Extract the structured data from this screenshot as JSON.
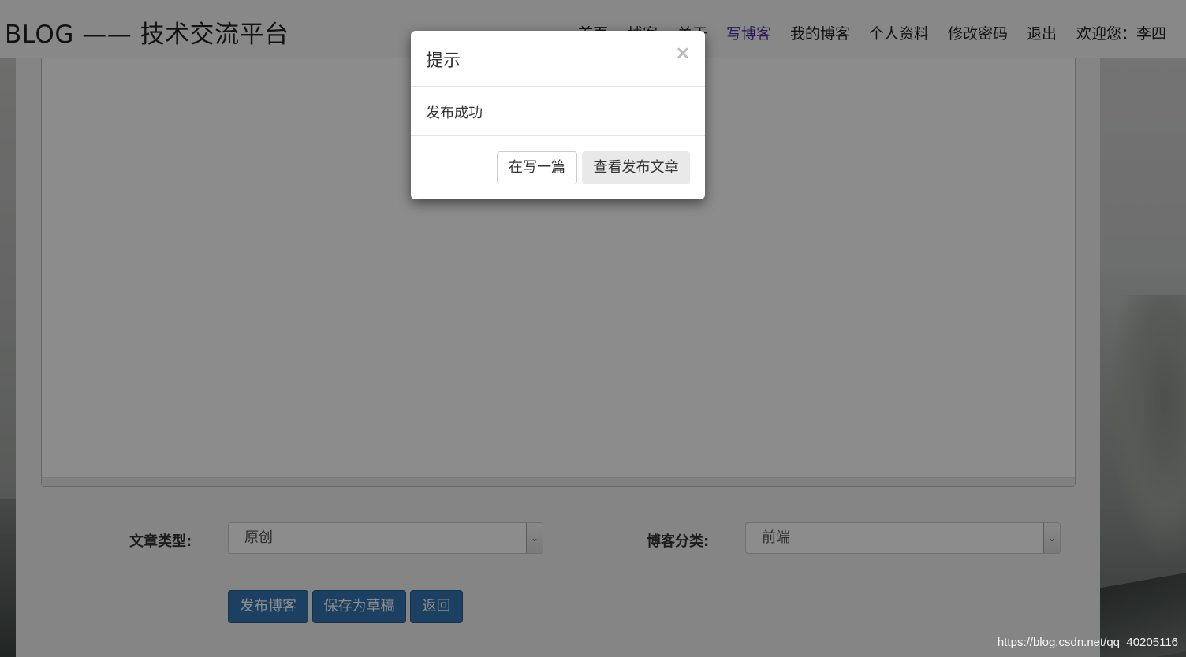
{
  "navbar": {
    "brand": "BLOG —— 技术交流平台",
    "items": [
      {
        "label": "首页"
      },
      {
        "label": "博客"
      },
      {
        "label": "关于"
      },
      {
        "label": "写博客",
        "active": true
      },
      {
        "label": "我的博客"
      },
      {
        "label": "个人资料"
      },
      {
        "label": "修改密码"
      },
      {
        "label": "退出"
      },
      {
        "label": "欢迎您：李四"
      }
    ],
    "active_color": "#5b2ea6"
  },
  "form": {
    "article_type": {
      "label": "文章类型:",
      "value": "原创"
    },
    "blog_category": {
      "label": "博客分类:",
      "value": "前端"
    }
  },
  "actions": {
    "publish": "发布博客",
    "save_draft": "保存为草稿",
    "back": "返回"
  },
  "modal": {
    "title": "提示",
    "close": "×",
    "message": "发布成功",
    "write_another": "在写一篇",
    "view_article": "查看发布文章"
  },
  "watermark": "https://blog.csdn.net/qq_40205116",
  "colors": {
    "primary_button": "#3276b1",
    "navbar_border": "#5aa7a7"
  }
}
